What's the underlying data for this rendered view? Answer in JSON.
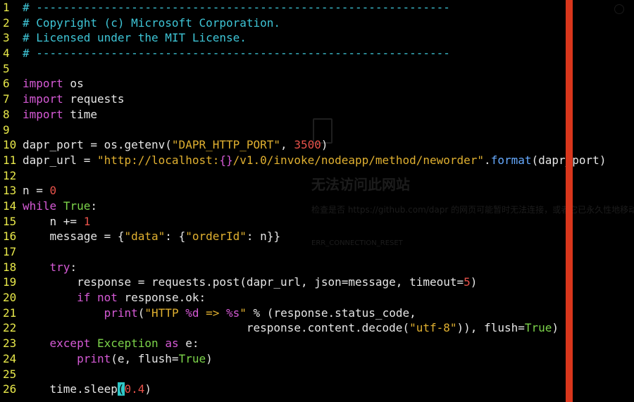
{
  "editor": {
    "colors": {
      "background": "#000000",
      "line_number": "#e8e84a",
      "comment": "#3ec5d6",
      "keyword": "#d65ad6",
      "string": "#e0b030",
      "number": "#e8524a",
      "builtin": "#7cd44a",
      "method": "#66aaff",
      "plain": "#e6e6e6",
      "margin_bar": "#d9361c"
    },
    "lines": [
      {
        "n": "1",
        "tokens": [
          {
            "t": "# -------------------------------------------------------------",
            "c": "comment"
          }
        ]
      },
      {
        "n": "2",
        "tokens": [
          {
            "t": "# Copyright (c) Microsoft Corporation.",
            "c": "comment"
          }
        ]
      },
      {
        "n": "3",
        "tokens": [
          {
            "t": "# Licensed under the MIT License.",
            "c": "comment"
          }
        ]
      },
      {
        "n": "4",
        "tokens": [
          {
            "t": "# -------------------------------------------------------------",
            "c": "comment"
          }
        ]
      },
      {
        "n": "5",
        "tokens": []
      },
      {
        "n": "6",
        "tokens": [
          {
            "t": "import",
            "c": "keyword"
          },
          {
            "t": " os",
            "c": "plain"
          }
        ]
      },
      {
        "n": "7",
        "tokens": [
          {
            "t": "import",
            "c": "keyword"
          },
          {
            "t": " requests",
            "c": "plain"
          }
        ]
      },
      {
        "n": "8",
        "tokens": [
          {
            "t": "import",
            "c": "keyword"
          },
          {
            "t": " time",
            "c": "plain"
          }
        ]
      },
      {
        "n": "9",
        "tokens": []
      },
      {
        "n": "10",
        "tokens": [
          {
            "t": "dapr_port = os.getenv(",
            "c": "plain"
          },
          {
            "t": "\"DAPR_HTTP_PORT\"",
            "c": "string"
          },
          {
            "t": ", ",
            "c": "plain"
          },
          {
            "t": "3500",
            "c": "number"
          },
          {
            "t": ")",
            "c": "plain"
          }
        ]
      },
      {
        "n": "11",
        "tokens": [
          {
            "t": "dapr_url = ",
            "c": "plain"
          },
          {
            "t": "\"http://localhost:",
            "c": "string"
          },
          {
            "t": "{}",
            "c": "keyword"
          },
          {
            "t": "/v1.0/invoke/nodeapp/method/neworder\"",
            "c": "string"
          },
          {
            "t": ".",
            "c": "plain"
          },
          {
            "t": "format",
            "c": "method"
          },
          {
            "t": "(dapr_port)",
            "c": "plain"
          }
        ]
      },
      {
        "n": "12",
        "tokens": []
      },
      {
        "n": "13",
        "tokens": [
          {
            "t": "n = ",
            "c": "plain"
          },
          {
            "t": "0",
            "c": "number"
          }
        ]
      },
      {
        "n": "14",
        "tokens": [
          {
            "t": "while",
            "c": "keyword"
          },
          {
            "t": " ",
            "c": "plain"
          },
          {
            "t": "True",
            "c": "builtin"
          },
          {
            "t": ":",
            "c": "plain"
          }
        ]
      },
      {
        "n": "15",
        "tokens": [
          {
            "t": "    n += ",
            "c": "plain"
          },
          {
            "t": "1",
            "c": "number"
          }
        ]
      },
      {
        "n": "16",
        "tokens": [
          {
            "t": "    message = {",
            "c": "plain"
          },
          {
            "t": "\"data\"",
            "c": "string"
          },
          {
            "t": ": {",
            "c": "plain"
          },
          {
            "t": "\"orderId\"",
            "c": "string"
          },
          {
            "t": ": n}}",
            "c": "plain"
          }
        ]
      },
      {
        "n": "17",
        "tokens": []
      },
      {
        "n": "18",
        "tokens": [
          {
            "t": "    ",
            "c": "plain"
          },
          {
            "t": "try",
            "c": "keyword"
          },
          {
            "t": ":",
            "c": "plain"
          }
        ]
      },
      {
        "n": "19",
        "tokens": [
          {
            "t": "        response = requests.post(dapr_url, json=message, timeout=",
            "c": "plain"
          },
          {
            "t": "5",
            "c": "number"
          },
          {
            "t": ")",
            "c": "plain"
          }
        ]
      },
      {
        "n": "20",
        "tokens": [
          {
            "t": "        ",
            "c": "plain"
          },
          {
            "t": "if",
            "c": "keyword"
          },
          {
            "t": " ",
            "c": "plain"
          },
          {
            "t": "not",
            "c": "keyword"
          },
          {
            "t": " response.ok:",
            "c": "plain"
          }
        ]
      },
      {
        "n": "21",
        "tokens": [
          {
            "t": "            ",
            "c": "plain"
          },
          {
            "t": "print",
            "c": "keyword"
          },
          {
            "t": "(",
            "c": "plain"
          },
          {
            "t": "\"HTTP ",
            "c": "string"
          },
          {
            "t": "%d",
            "c": "keyword"
          },
          {
            "t": " => ",
            "c": "string"
          },
          {
            "t": "%s",
            "c": "keyword"
          },
          {
            "t": "\"",
            "c": "string"
          },
          {
            "t": " % (response.status_code,",
            "c": "plain"
          }
        ]
      },
      {
        "n": "22",
        "tokens": [
          {
            "t": "                                 response.content.decode(",
            "c": "plain"
          },
          {
            "t": "\"utf-8\"",
            "c": "string"
          },
          {
            "t": ")), flush=",
            "c": "plain"
          },
          {
            "t": "True",
            "c": "builtin"
          },
          {
            "t": ")",
            "c": "plain"
          }
        ]
      },
      {
        "n": "23",
        "tokens": [
          {
            "t": "    ",
            "c": "plain"
          },
          {
            "t": "except",
            "c": "keyword"
          },
          {
            "t": " ",
            "c": "plain"
          },
          {
            "t": "Exception",
            "c": "builtin"
          },
          {
            "t": " ",
            "c": "plain"
          },
          {
            "t": "as",
            "c": "keyword"
          },
          {
            "t": " e:",
            "c": "plain"
          }
        ]
      },
      {
        "n": "24",
        "tokens": [
          {
            "t": "        ",
            "c": "plain"
          },
          {
            "t": "print",
            "c": "keyword"
          },
          {
            "t": "(e, flush=",
            "c": "plain"
          },
          {
            "t": "True",
            "c": "builtin"
          },
          {
            "t": ")",
            "c": "plain"
          }
        ]
      },
      {
        "n": "25",
        "tokens": []
      },
      {
        "n": "26",
        "tokens": [
          {
            "t": "    time.sleep",
            "c": "plain"
          },
          {
            "t": "(",
            "c": "cursor"
          },
          {
            "t": "0.4",
            "c": "number"
          },
          {
            "t": ")",
            "c": "plain"
          }
        ]
      }
    ]
  },
  "background_page": {
    "title": "无法访问此网站",
    "message": "检查是否 https://github.com/dapr 的网页可能暂时无法连接，或者它已永久性地移动到了新网址。",
    "error_code": "ERR_CONNECTION_RESET",
    "icon": "broken-page-icon"
  }
}
